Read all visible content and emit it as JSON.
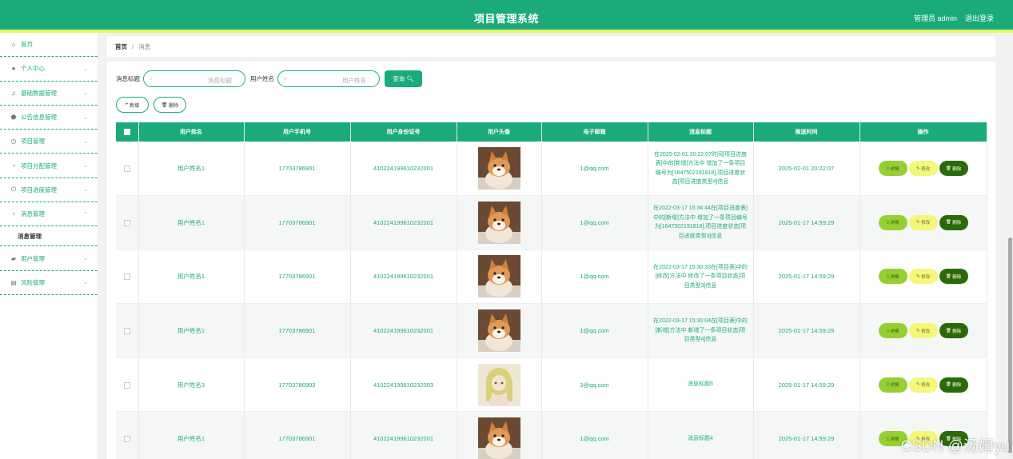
{
  "header": {
    "title": "项目管理系统",
    "user_label": "管理员 admin",
    "logout_label": "退出登录",
    "colors": {
      "primary": "#1bab78",
      "accent": "#e8f56a"
    }
  },
  "sidebar": {
    "items": [
      {
        "label": "首页",
        "icon": "home-icon"
      },
      {
        "label": "个人中心",
        "icon": "user-icon"
      },
      {
        "label": "基础数据管理",
        "icon": "bell-icon"
      },
      {
        "label": "公告信息管理",
        "icon": "shield-icon"
      },
      {
        "label": "项目管理",
        "icon": "clock-icon"
      },
      {
        "label": "项目分配管理",
        "icon": "dashboard-icon"
      },
      {
        "label": "项目进度管理",
        "icon": "power-icon"
      },
      {
        "label": "消息管理",
        "icon": "pin-icon"
      },
      {
        "label": "用户管理",
        "icon": "briefcase-icon"
      },
      {
        "label": "风险管理",
        "icon": "clipboard-icon"
      }
    ],
    "submenu_label": "消息管理"
  },
  "breadcrumb": {
    "home": "首页",
    "separator": "/",
    "current": "消息"
  },
  "search": {
    "title_label": "消息标题",
    "title_placeholder": "消息标题",
    "name_label": "用户姓名",
    "name_placeholder": "用户姓名",
    "query_label": "查询"
  },
  "toolbar": {
    "add_label": "新增",
    "delete_label": "删除"
  },
  "table": {
    "headers": [
      "用户姓名",
      "用户手机号",
      "用户身份证号",
      "用户头像",
      "电子邮箱",
      "消息标题",
      "推送时间",
      "操作"
    ],
    "buttons": {
      "detail": "详情",
      "edit": "修改",
      "delete": "删除"
    },
    "rows": [
      {
        "name": "用户姓名1",
        "phone": "17703786901",
        "id_card": "410224199610232001",
        "avatar": "shiba-dog-avatar",
        "email": "1@qq.com",
        "title": "在2025-02-01 20:22:07时间[项目进度表]中的[新增]方法中 增加了一条项目编号为[1647502191818],项目进度状态[项目进度类型4]信息",
        "time": "2025-02-01 20:22:07"
      },
      {
        "name": "用户姓名1",
        "phone": "17703786901",
        "id_card": "410224199610232001",
        "avatar": "shiba-dog-avatar",
        "email": "1@qq.com",
        "title": "在2022-03-17 15:34:44在[项目进度表]中的[新增]方法中 增加了一条项目编号为[1647502191818],项目进度状态[项目进度类型3]信息",
        "time": "2025-01-17 14:59:29"
      },
      {
        "name": "用户姓名1",
        "phone": "17703786901",
        "id_card": "410224199610232001",
        "avatar": "shiba-dog-avatar",
        "email": "1@qq.com",
        "title": "在2022-03-17 15:30:33在[项目表]中的[修改]方法中 修改了一条项目状态[项目类型3]信息",
        "time": "2025-01-17 14:59:29"
      },
      {
        "name": "用户姓名1",
        "phone": "17703786901",
        "id_card": "410224199610232001",
        "avatar": "shiba-dog-avatar",
        "email": "1@qq.com",
        "title": "在2022-03-17 15:30:04在[项目表]中的[新增]方法中 新增了一条项目状态[项目类型4]信息",
        "time": "2025-01-17 14:59:29"
      },
      {
        "name": "用户姓名3",
        "phone": "17703786903",
        "id_card": "410224199610232003",
        "avatar": "anime-girl-avatar",
        "email": "3@qq.com",
        "title": "消息标题5",
        "time": "2025-01-17 14:59:29"
      },
      {
        "name": "用户姓名1",
        "phone": "17703786901",
        "id_card": "410224199610232001",
        "avatar": "shiba-dog-avatar",
        "email": "1@qq.com",
        "title": "消息标题4",
        "time": "2025-01-17 14:59:29"
      }
    ]
  },
  "watermark": "CSDN @汤姆yu"
}
